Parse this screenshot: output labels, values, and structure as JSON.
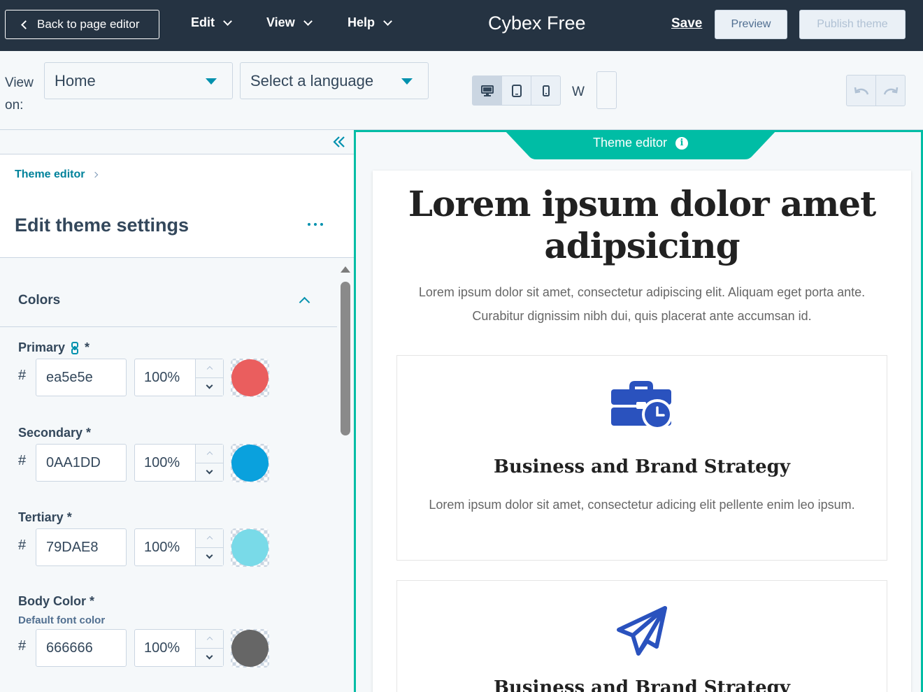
{
  "topbar": {
    "back_label": "Back to page editor",
    "menus": [
      "Edit",
      "View",
      "Help"
    ],
    "title": "Cybex Free",
    "save_label": "Save",
    "preview_label": "Preview",
    "publish_label": "Publish theme"
  },
  "toolbar": {
    "view_on_label": "View on:",
    "page_select": "Home",
    "language_select": "Select a language",
    "devices": [
      "desktop-icon",
      "tablet-icon",
      "mobile-icon"
    ],
    "active_device": "desktop",
    "width_label": "W",
    "width_value": ""
  },
  "sidebar": {
    "breadcrumb": "Theme editor",
    "title": "Edit theme settings",
    "section": {
      "title": "Colors",
      "expanded": true
    },
    "fields": [
      {
        "label": "Primary",
        "required": "*",
        "linked_icon": "link-icon",
        "help": "",
        "hex": "ea5e5e",
        "opacity": "100%",
        "color": "#ea5e5e"
      },
      {
        "label": "Secondary",
        "required": "*",
        "help": "",
        "hex": "0AA1DD",
        "opacity": "100%",
        "color": "#0AA1DD"
      },
      {
        "label": "Tertiary",
        "required": "*",
        "help": "",
        "hex": "79DAE8",
        "opacity": "100%",
        "color": "#79DAE8"
      },
      {
        "label": "Body Color",
        "required": "*",
        "help": "Default font color",
        "hex": "666666",
        "opacity": "100%",
        "color": "#666666"
      }
    ]
  },
  "preview": {
    "tab_label": "Theme editor",
    "hero_title": "Lorem ipsum dolor amet adipsicing",
    "hero_text": "Lorem ipsum dolor sit amet, consectetur adipiscing elit. Aliquam eget porta ante. Curabitur dignissim nibh dui, quis placerat ante accumsan id.",
    "cards": [
      {
        "icon": "briefcase-clock-icon",
        "title": "Business and Brand Strategy",
        "text": "Lorem ipsum dolor sit amet, consectetur adicing elit pellente enim leo ipsum."
      },
      {
        "icon": "paper-plane-icon",
        "title": "Business and Brand Strategy",
        "text": ""
      }
    ]
  },
  "colors": {
    "topbar_bg": "#253342",
    "accent": "#00bda5",
    "link": "#0091ae",
    "icon_blue": "#2a52be"
  }
}
